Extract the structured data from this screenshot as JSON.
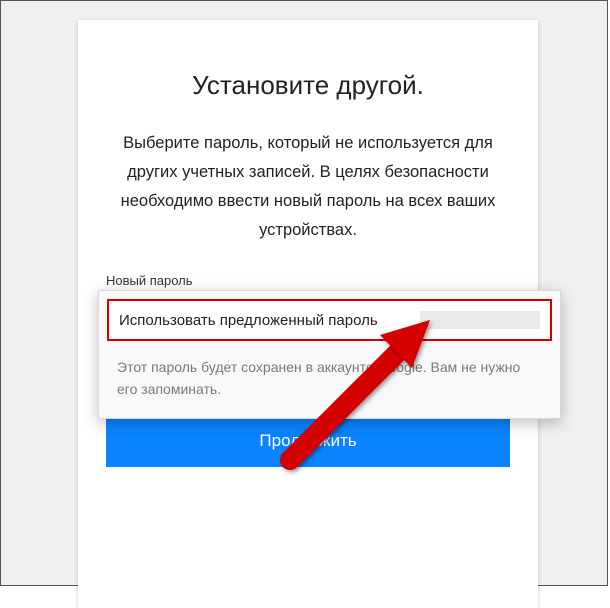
{
  "dialog": {
    "title": "Установите другой.",
    "description": "Выберите пароль, который не используется для других учетных записей. В целях безопасности необходимо ввести новый пароль на всех ваших устройствах.",
    "field_label": "Новый пароль",
    "continue_label": "Продолжить"
  },
  "suggestion": {
    "use_label": "Использовать предложенный пароль",
    "note": "Этот пароль будет сохранен в аккаунте Google. Вам не нужно его запоминать."
  }
}
